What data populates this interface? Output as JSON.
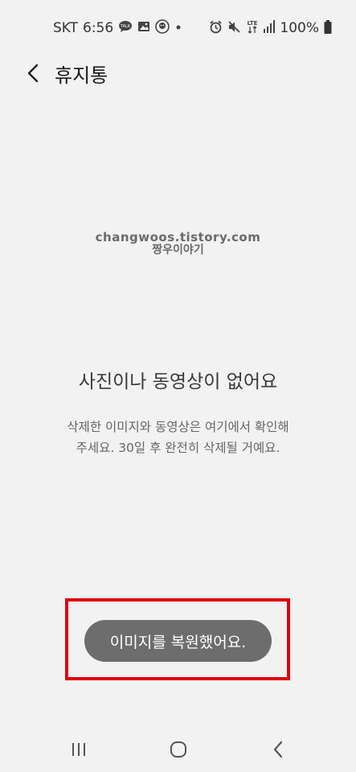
{
  "status_bar": {
    "carrier": "SKT",
    "time": "6:56",
    "notification_icons": [
      "talk-icon",
      "image-icon",
      "app-icon",
      "dot-icon"
    ],
    "system_icons": [
      "alarm-icon",
      "mute-icon",
      "lte-icon",
      "signal-icon"
    ],
    "battery": "100%"
  },
  "header": {
    "title": "휴지통"
  },
  "watermark": {
    "line1": "changwoos.tistory.com",
    "line2": "짱우이야기"
  },
  "empty_state": {
    "title": "사진이나 동영상이 없어요",
    "description_line1": "삭제한 이미지와 동영상은 여기에서 확인해",
    "description_line2": "주세요. 30일 후 완전히 삭제될 거예요."
  },
  "toast": {
    "message": "이미지를 복원했어요."
  },
  "colors": {
    "background": "#f2f2f2",
    "toast_background": "#6d6d6d",
    "highlight_border": "#e0000b"
  }
}
